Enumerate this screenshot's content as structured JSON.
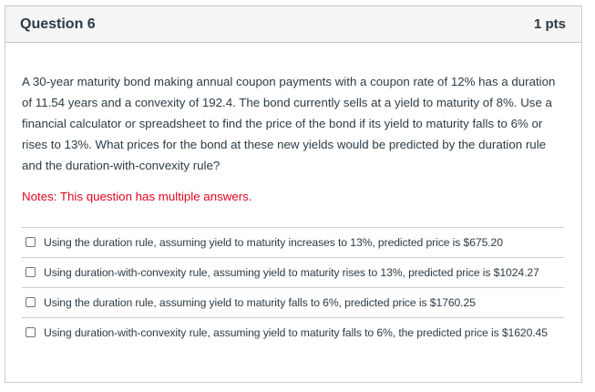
{
  "question": {
    "title": "Question 6",
    "points": "1 pts",
    "text": "A 30-year maturity bond making annual coupon payments with a coupon rate of 12% has a duration of 11.54 years and a convexity of 192.4. The bond currently sells at a yield to maturity of 8%. Use a financial calculator or spreadsheet to find the price of the bond if its yield to maturity falls to 6% or rises to 13%. What prices for the bond at these new yields would be predicted by the duration rule and the duration-with-convexity rule?",
    "notes": "Notes: This question has multiple answers."
  },
  "answers": [
    {
      "label": "Using the duration rule, assuming yield to maturity increases to 13%, predicted price is $675.20",
      "checked": false
    },
    {
      "label": "Using duration-with-convexity rule, assuming yield to maturity rises to 13%, predicted price is $1024.27",
      "checked": false
    },
    {
      "label": "Using the duration rule, assuming yield to maturity falls to 6%, predicted price is $1760.25",
      "checked": false
    },
    {
      "label": "Using duration-with-convexity rule, assuming yield to maturity falls to 6%, the predicted price is $1620.45",
      "checked": false
    }
  ],
  "colors": {
    "header_bg": "#f5f5f5",
    "border": "#c7cdd1",
    "text": "#2d3b45",
    "notes": "#e0061f"
  }
}
